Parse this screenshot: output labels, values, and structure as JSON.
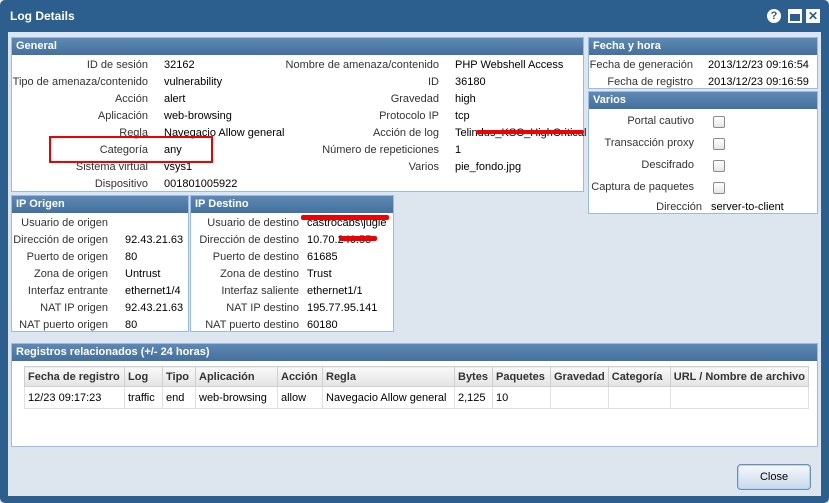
{
  "window": {
    "title": "Log Details",
    "help_icon": "?",
    "close_icon": "✕"
  },
  "general": {
    "header": "General",
    "left": [
      {
        "label": "ID de sesión",
        "value": "32162"
      },
      {
        "label": "Tipo de amenaza/contenido",
        "value": "vulnerability"
      },
      {
        "label": "Acción",
        "value": "alert"
      },
      {
        "label": "Aplicación",
        "value": "web-browsing"
      },
      {
        "label": "Regla",
        "value": "Navegacio Allow general"
      },
      {
        "label": "Categoría",
        "value": "any"
      },
      {
        "label": "Sistema virtual",
        "value": "vsys1"
      },
      {
        "label": "Dispositivo",
        "value": "001801005922"
      }
    ],
    "right": [
      {
        "label": "Nombre de amenaza/contenido",
        "value": "PHP Webshell Access"
      },
      {
        "label": "ID",
        "value": "36180"
      },
      {
        "label": "Gravedad",
        "value": "high"
      },
      {
        "label": "Protocolo IP",
        "value": "tcp"
      },
      {
        "label": "Acción de log",
        "value": "Telindus_KSC_HighCritical"
      },
      {
        "label": "Número de repeticiones",
        "value": "1"
      },
      {
        "label": "Varios",
        "value": "pie_fondo.jpg"
      }
    ]
  },
  "fecha": {
    "header": "Fecha y hora",
    "rows": [
      {
        "label": "Fecha de generación",
        "value": "2013/12/23 09:16:54"
      },
      {
        "label": "Fecha de registro",
        "value": "2013/12/23 09:16:59"
      }
    ]
  },
  "varios": {
    "header": "Varios",
    "checks": [
      {
        "label": "Portal cautivo",
        "checked": false
      },
      {
        "label": "Transacción proxy",
        "checked": false
      },
      {
        "label": "Descifrado",
        "checked": false
      },
      {
        "label": "Captura de paquetes",
        "checked": false
      }
    ],
    "direction_label": "Dirección",
    "direction_value": "server-to-client"
  },
  "ip_origen": {
    "header": "IP Origen",
    "rows": [
      {
        "label": "Usuario de origen",
        "value": ""
      },
      {
        "label": "Dirección de origen",
        "value": "92.43.21.63"
      },
      {
        "label": "Puerto de origen",
        "value": "80"
      },
      {
        "label": "Zona de origen",
        "value": "Untrust"
      },
      {
        "label": "Interfaz entrante",
        "value": "ethernet1/4"
      },
      {
        "label": "NAT IP origen",
        "value": "92.43.21.63"
      },
      {
        "label": "NAT puerto origen",
        "value": "80"
      }
    ]
  },
  "ip_destino": {
    "header": "IP Destino",
    "rows": [
      {
        "label": "Usuario de destino",
        "value": "castrocabs\\jugle"
      },
      {
        "label": "Dirección de destino",
        "value": "10.70.240.55"
      },
      {
        "label": "Puerto de destino",
        "value": "61685"
      },
      {
        "label": "Zona de destino",
        "value": "Trust"
      },
      {
        "label": "Interfaz saliente",
        "value": "ethernet1/1"
      },
      {
        "label": "NAT IP destino",
        "value": "195.77.95.141"
      },
      {
        "label": "NAT puerto destino",
        "value": "60180"
      }
    ]
  },
  "registros": {
    "header": "Registros relacionados (+/- 24 horas)",
    "columns": [
      "Fecha de registro",
      "Log",
      "Tipo",
      "Aplicación",
      "Acción",
      "Regla",
      "Bytes",
      "Paquetes",
      "Gravedad",
      "Categoría",
      "URL / Nombre de archivo"
    ],
    "rows": [
      [
        "12/23 09:17:23",
        "traffic",
        "end",
        "web-browsing",
        "allow",
        "Navegacio Allow general",
        "2,125",
        "10",
        "",
        "",
        ""
      ]
    ]
  },
  "footer": {
    "close_label": "Close"
  },
  "colors": {
    "titlebar": "#2d5f8e",
    "panel_header": "#5079a5",
    "redaction": "#ee0000"
  }
}
